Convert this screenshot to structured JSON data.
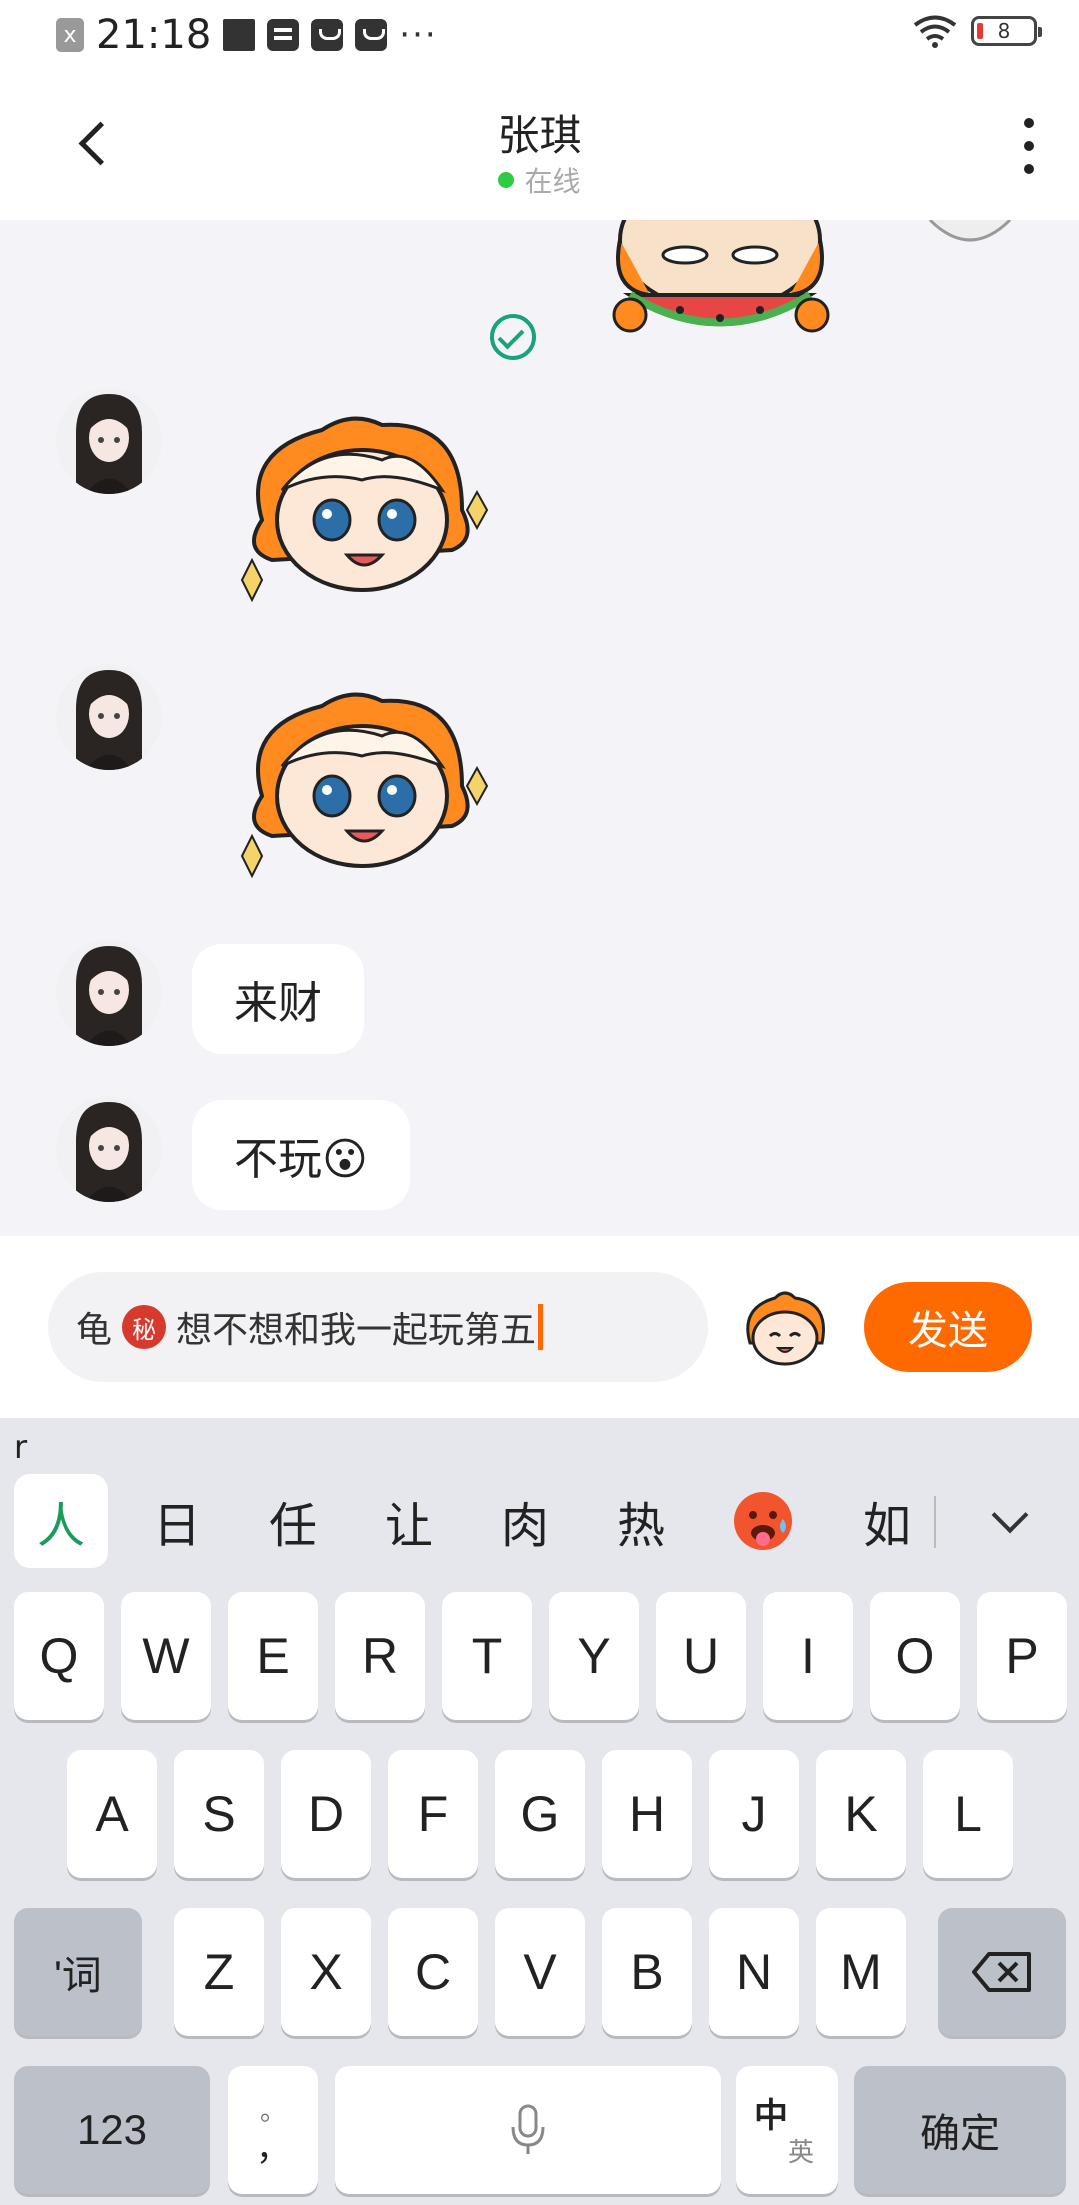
{
  "status_bar": {
    "time": "21:18",
    "notif_x": "x",
    "more": "···",
    "battery": "8"
  },
  "header": {
    "title": "张琪",
    "status": "在线"
  },
  "messages": [
    {
      "type": "sticker",
      "side": "right",
      "name": "watermelon-sticker"
    },
    {
      "type": "sticker",
      "side": "left",
      "name": "girl-sticker"
    },
    {
      "type": "sticker",
      "side": "left",
      "name": "girl-sticker"
    },
    {
      "type": "text",
      "side": "left",
      "text": "来财"
    },
    {
      "type": "text",
      "side": "left",
      "text": "不玩😮"
    }
  ],
  "input": {
    "prefix": "龟",
    "secret_badge": "秘",
    "text": "想不想和我一起玩第五",
    "send_label": "发送"
  },
  "keyboard": {
    "pinyin": "r",
    "candidates": [
      "人",
      "日",
      "任",
      "让",
      "肉",
      "热",
      "🥵",
      "如"
    ],
    "row1": [
      "Q",
      "W",
      "E",
      "R",
      "T",
      "Y",
      "U",
      "I",
      "O",
      "P"
    ],
    "row2": [
      "A",
      "S",
      "D",
      "F",
      "G",
      "H",
      "J",
      "K",
      "L"
    ],
    "row3": [
      "Z",
      "X",
      "C",
      "V",
      "B",
      "N",
      "M"
    ],
    "word_key": "'词",
    "num_key": "123",
    "punct_top": "。",
    "punct_bottom": "，",
    "lang_zh": "中",
    "lang_en": "英",
    "confirm_key": "确定"
  },
  "colors": {
    "accent": "#ff6a00",
    "online": "#2ecc40",
    "check": "#18a37e",
    "candidate_selected": "#1a9c5a"
  }
}
